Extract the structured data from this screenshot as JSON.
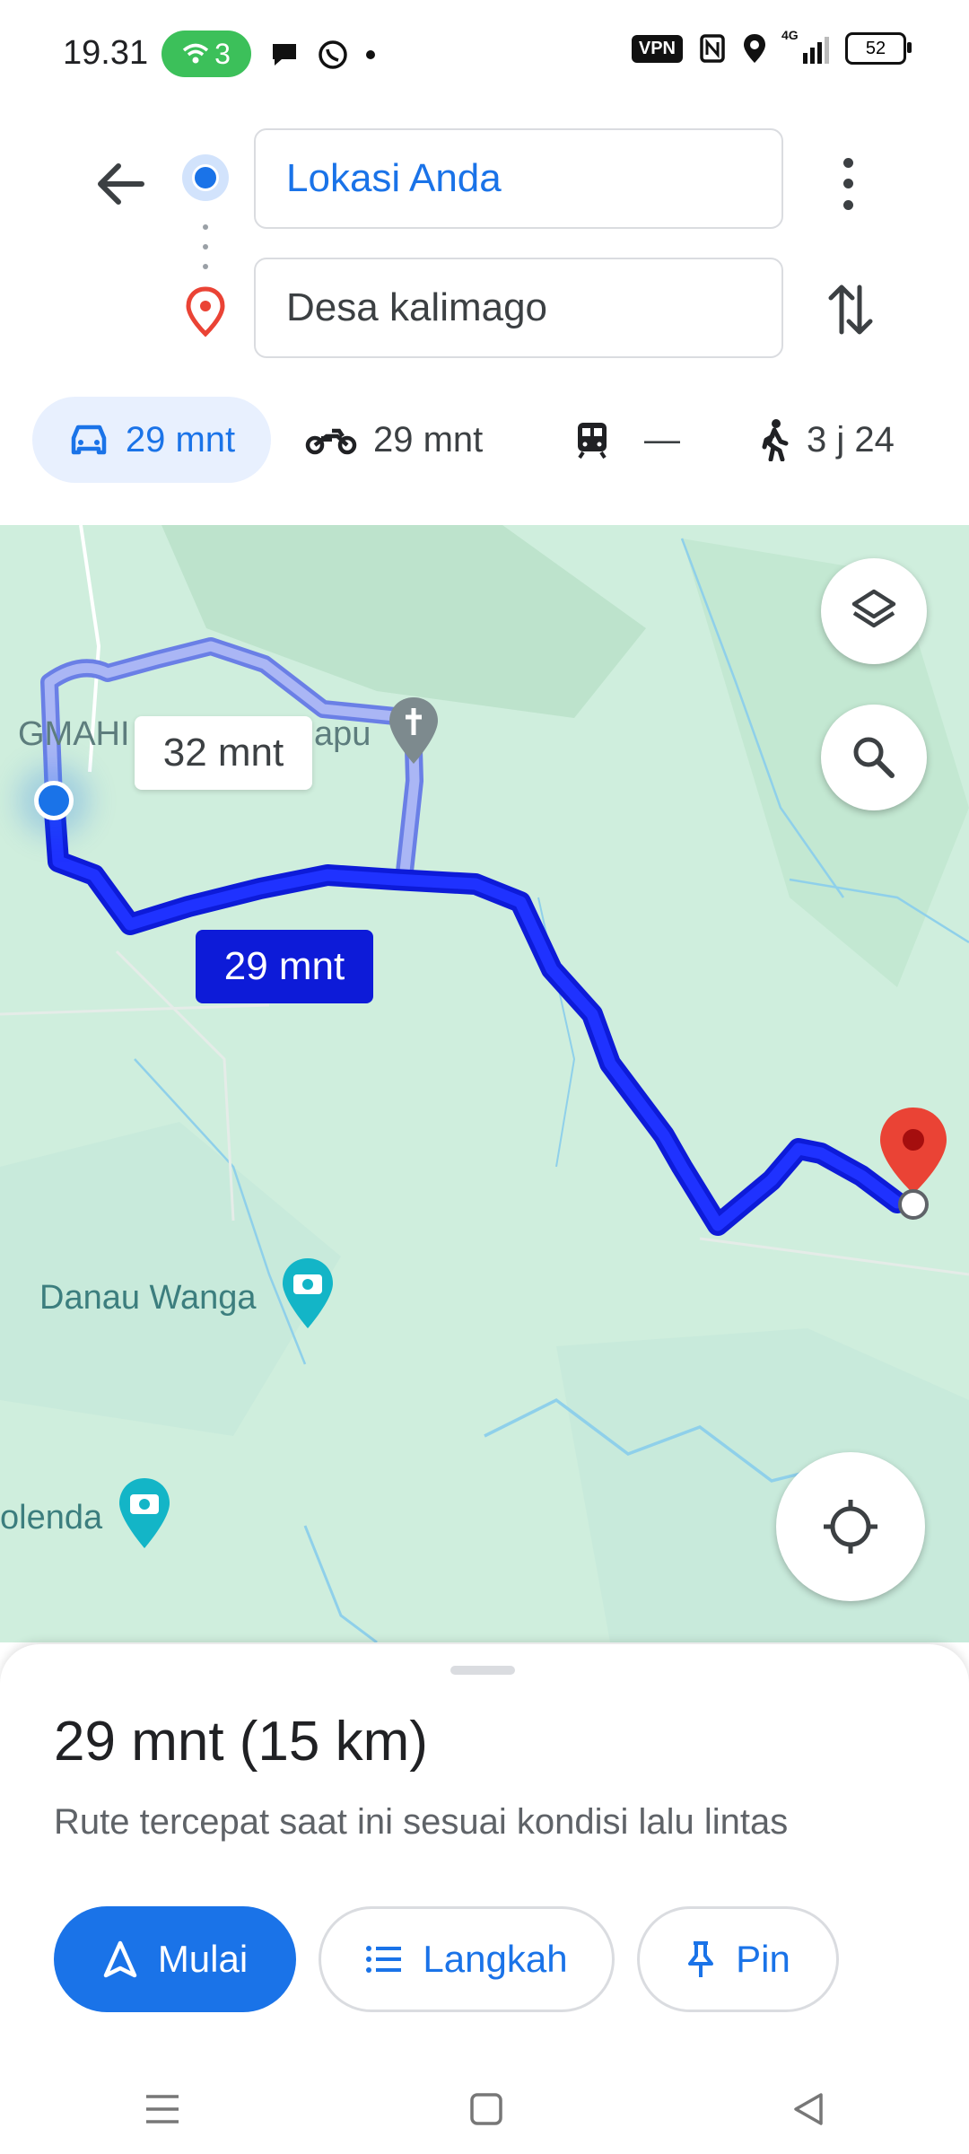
{
  "status_bar": {
    "time": "19.31",
    "wifi_count": "3",
    "vpn": "VPN",
    "network": "4G",
    "battery": "52"
  },
  "directions": {
    "origin": "Lokasi Anda",
    "destination": "Desa kalimago"
  },
  "modes": [
    {
      "name": "car",
      "label": "29 mnt",
      "selected": true
    },
    {
      "name": "motorcycle",
      "label": "29 mnt"
    },
    {
      "name": "transit",
      "label": "—"
    },
    {
      "name": "walk",
      "label": "3 j 24"
    }
  ],
  "map": {
    "labels": [
      "GMAHI",
      "apu",
      "Danau Wanga",
      "olenda"
    ],
    "route_main_label": "29 mnt",
    "route_alt_label": "32 mnt"
  },
  "sheet": {
    "eta": "29 mnt (15 km)",
    "subtitle": "Rute tercepat saat ini sesuai kondisi lalu lintas",
    "start_label": "Mulai",
    "steps_label": "Langkah",
    "pin_label": "Pin"
  },
  "colors": {
    "accent": "#1a73e8",
    "route_main": "#0d1bd8",
    "route_alt": "#8c99f2",
    "map_bg": "#cfeedd",
    "destination_pin": "#ea4335"
  }
}
